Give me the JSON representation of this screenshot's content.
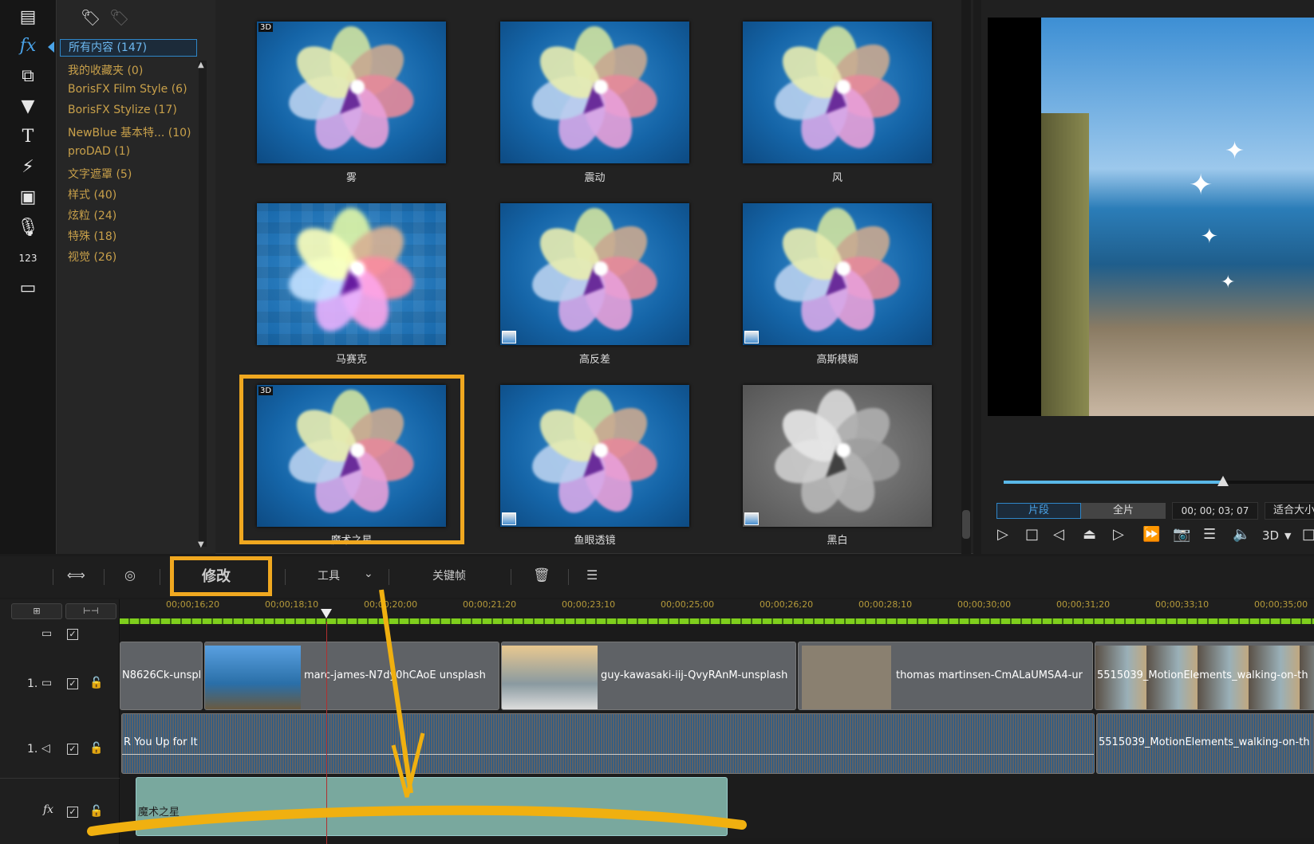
{
  "sidebar": {
    "icons": [
      "media-icon",
      "fx-icon",
      "transition-icon",
      "particle-icon",
      "title-icon",
      "pip-icon",
      "chapter-icon",
      "voice-icon",
      "subtitle-number-icon",
      "caption-icon"
    ]
  },
  "categories": {
    "items": [
      {
        "label": "所有内容 (147)",
        "selected": true
      },
      {
        "label": "我的收藏夹  (0)"
      },
      {
        "label": "BorisFX Film Style  (6)"
      },
      {
        "label": "BorisFX Stylize  (17)"
      },
      {
        "label": "NewBlue 基本特...  (10)"
      },
      {
        "label": "proDAD  (1)"
      },
      {
        "label": "文字遮罩  (5)"
      },
      {
        "label": "样式  (40)"
      },
      {
        "label": "炫粒  (24)"
      },
      {
        "label": "特殊  (18)"
      },
      {
        "label": "视觉  (26)"
      }
    ]
  },
  "effects": [
    {
      "label": "雾",
      "badge": "3D"
    },
    {
      "label": "震动"
    },
    {
      "label": "风"
    },
    {
      "label": "马赛克"
    },
    {
      "label": "高反差",
      "badge2": true
    },
    {
      "label": "高斯模糊",
      "badge2": true
    },
    {
      "label": "魔术之星",
      "badge": "3D",
      "highlighted": true
    },
    {
      "label": "鱼眼透镜",
      "badge2": true
    },
    {
      "label": "黑白",
      "badge2": true
    }
  ],
  "preview": {
    "tab_clip": "片段",
    "tab_full": "全片",
    "timecode": "00; 00; 03; 07",
    "fit": "适合大小",
    "three_d": "3D",
    "progress": 0.72
  },
  "toolbar": {
    "modify": "修改",
    "tools": "工具",
    "keyframe": "关键帧"
  },
  "ruler": [
    "00;00;16;20",
    "00;00;18;10",
    "00;00;20;00",
    "00;00;21;20",
    "00;00;23;10",
    "00;00;25;00",
    "00;00;26;20",
    "00;00;28;10",
    "00;00;30;00",
    "00;00;31;20",
    "00;00;33;10",
    "00;00;35;00"
  ],
  "tracks": {
    "video_label": "1.",
    "audio_label": "1.",
    "fx_label": "fx",
    "video_clips": [
      "N8626Ck-unspl",
      "marc-james-N7dy0hCAoE unsplash",
      "guy-kawasaki-iij-QvyRAnM-unsplash",
      "thomas martinsen-CmALaUMSA4-ur",
      "5515039_MotionElements_walking-on-th"
    ],
    "audio_clips": [
      "R You Up for It",
      "5515039_MotionElements_walking-on-th"
    ],
    "fx_clip": "魔术之星"
  },
  "colors": {
    "accent": "#f0a820",
    "category": "#c8a04a",
    "selection": "#2f86c8",
    "fx_clip": "#79a89e"
  }
}
